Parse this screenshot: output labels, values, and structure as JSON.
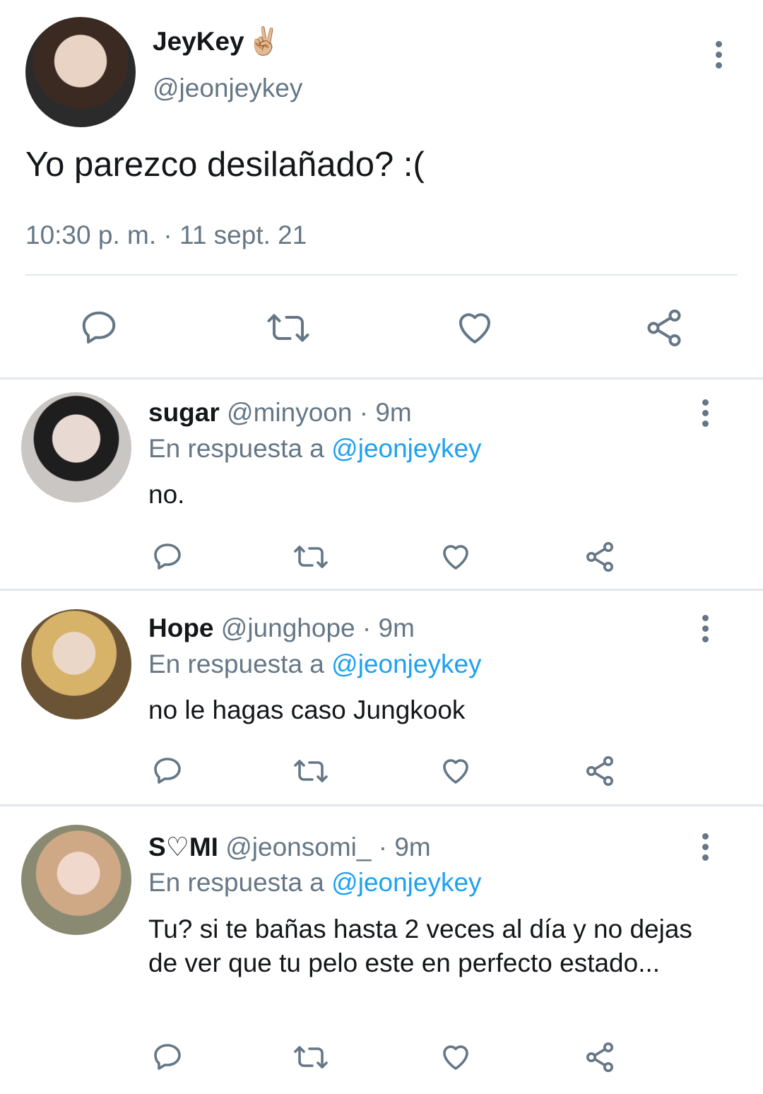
{
  "main_tweet": {
    "name": "JeyKey",
    "emoji": "✌🏼",
    "handle": "@jeonjeykey",
    "text": "Yo parezco desilañado? :(",
    "timestamp": "10:30 p. m. · 11 sept. 21",
    "actions": [
      "reply-icon",
      "retweet-icon",
      "like-icon",
      "share-icon"
    ]
  },
  "replies": [
    {
      "name": "sugar",
      "handle": "@minyoon",
      "time": "· 9m",
      "in_reply_label": "En respuesta a",
      "in_reply_to": "@jeonjeykey",
      "text": "no."
    },
    {
      "name": "Hope",
      "handle": "@junghope",
      "time": "· 9m",
      "in_reply_label": "En respuesta a",
      "in_reply_to": "@jeonjeykey",
      "text": "no le hagas caso Jungkook"
    },
    {
      "name": "S♡MI",
      "handle": "@jeonsomi_",
      "time": "· 9m",
      "in_reply_label": "En respuesta a",
      "in_reply_to": "@jeonjeykey",
      "text": "Tu? si te bañas hasta 2 veces al día y no dejas de ver que tu pelo este en perfecto estado..."
    }
  ],
  "colors": {
    "text": "#14171a",
    "secondary": "#657786",
    "link": "#1da1f2",
    "divider": "#e1e8ed"
  }
}
